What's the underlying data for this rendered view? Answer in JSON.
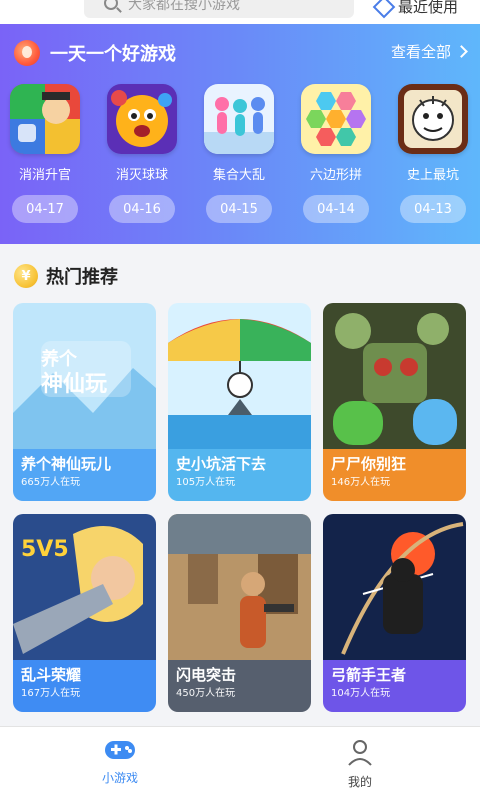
{
  "search": {
    "placeholder": "大家都在搜小游戏"
  },
  "header": {
    "recent_label": "最近使用"
  },
  "daily": {
    "title": "一天一个好游戏",
    "view_all": "查看全部",
    "items": [
      {
        "name": "消消升官",
        "date": "04-17",
        "icon": "game-xiaoxiao-icon"
      },
      {
        "name": "消灭球球",
        "date": "04-16",
        "icon": "game-ball-icon"
      },
      {
        "name": "集合大乱",
        "date": "04-15",
        "icon": "game-crowd-icon"
      },
      {
        "name": "六边形拼",
        "date": "04-14",
        "icon": "game-hexagon-icon"
      },
      {
        "name": "史上最坑",
        "date": "04-13",
        "icon": "game-face-icon"
      }
    ]
  },
  "hot": {
    "title": "热门推荐",
    "coin_symbol": "¥",
    "cards": [
      {
        "name": "养个神仙玩儿",
        "players": "665万人在玩",
        "art_text": "养个\n神仙玩",
        "color": "#52a6f5"
      },
      {
        "name": "史小坑活下去",
        "players": "105万人在玩",
        "color": "#54b6ef"
      },
      {
        "name": "尸尸你别狂",
        "players": "146万人在玩",
        "color": "#f08e2a"
      },
      {
        "name": "乱斗荣耀",
        "players": "167万人在玩",
        "art_text": "5V5",
        "color": "#3f8cf3"
      },
      {
        "name": "闪电突击",
        "players": "450万人在玩",
        "color": "#565f6e"
      },
      {
        "name": "弓箭手王者",
        "players": "104万人在玩",
        "color": "#6e55e8"
      }
    ]
  },
  "nav": {
    "tabs": [
      {
        "label": "小游戏",
        "active": true
      },
      {
        "label": "我的",
        "active": false
      }
    ]
  },
  "colors": {
    "accent": "#3d8bf2",
    "banner_start": "#7a63f7",
    "banner_end": "#5fb7fb"
  }
}
